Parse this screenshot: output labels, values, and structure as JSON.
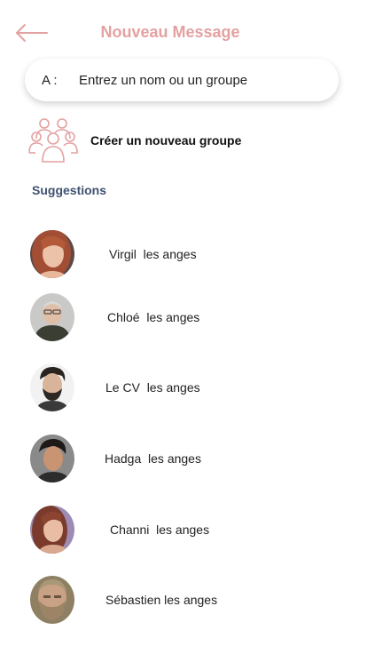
{
  "header": {
    "title": "Nouveau Message",
    "back_icon": "arrow-left-icon"
  },
  "to_field": {
    "label": "A :",
    "placeholder": "Entrez un nom ou un groupe",
    "value": ""
  },
  "new_group": {
    "icon": "group-icon",
    "label": "Créer un nouveau groupe"
  },
  "suggestions": {
    "title": "Suggestions",
    "contacts": [
      {
        "name": "Virgil  les anges"
      },
      {
        "name": "Chloé  les anges"
      },
      {
        "name": "Le CV  les anges"
      },
      {
        "name": "Hadga  les anges"
      },
      {
        "name": "Channi  les anges"
      },
      {
        "name": "Sébastien les anges"
      }
    ]
  },
  "colors": {
    "accent": "#e4a1a1",
    "section_title": "#3e5170"
  }
}
